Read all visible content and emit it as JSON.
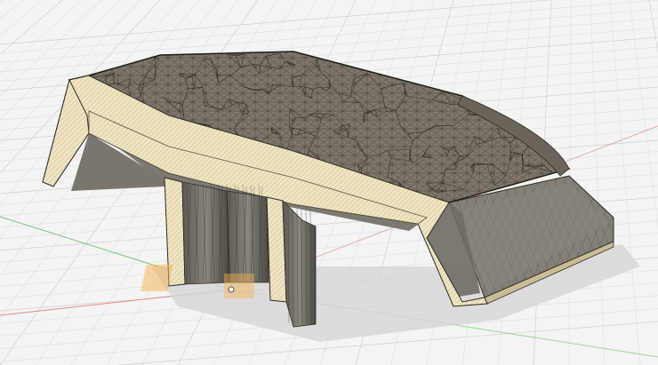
{
  "viewport": {
    "view_mode": "section-analysis-mesh",
    "colors": {
      "background": "#f4f4f4",
      "grid_minor": "#e2e2e2",
      "grid_major": "#cfcfcf",
      "axis_x": "#e08a8a",
      "axis_y": "#7bc47b",
      "axis_z": "#4d6bd8",
      "section_fill": "#efe5c3",
      "section_hatch": "#b9a878",
      "mesh_top": "#7e776b",
      "mesh_side": "#858178",
      "mesh_line": "#2d2a25",
      "shadow": "#d6d6d6",
      "gizmo": "#f5b24d"
    },
    "icons": {
      "origin": "origin-gizmo-icon",
      "axis": "axis-triad-icon"
    }
  }
}
